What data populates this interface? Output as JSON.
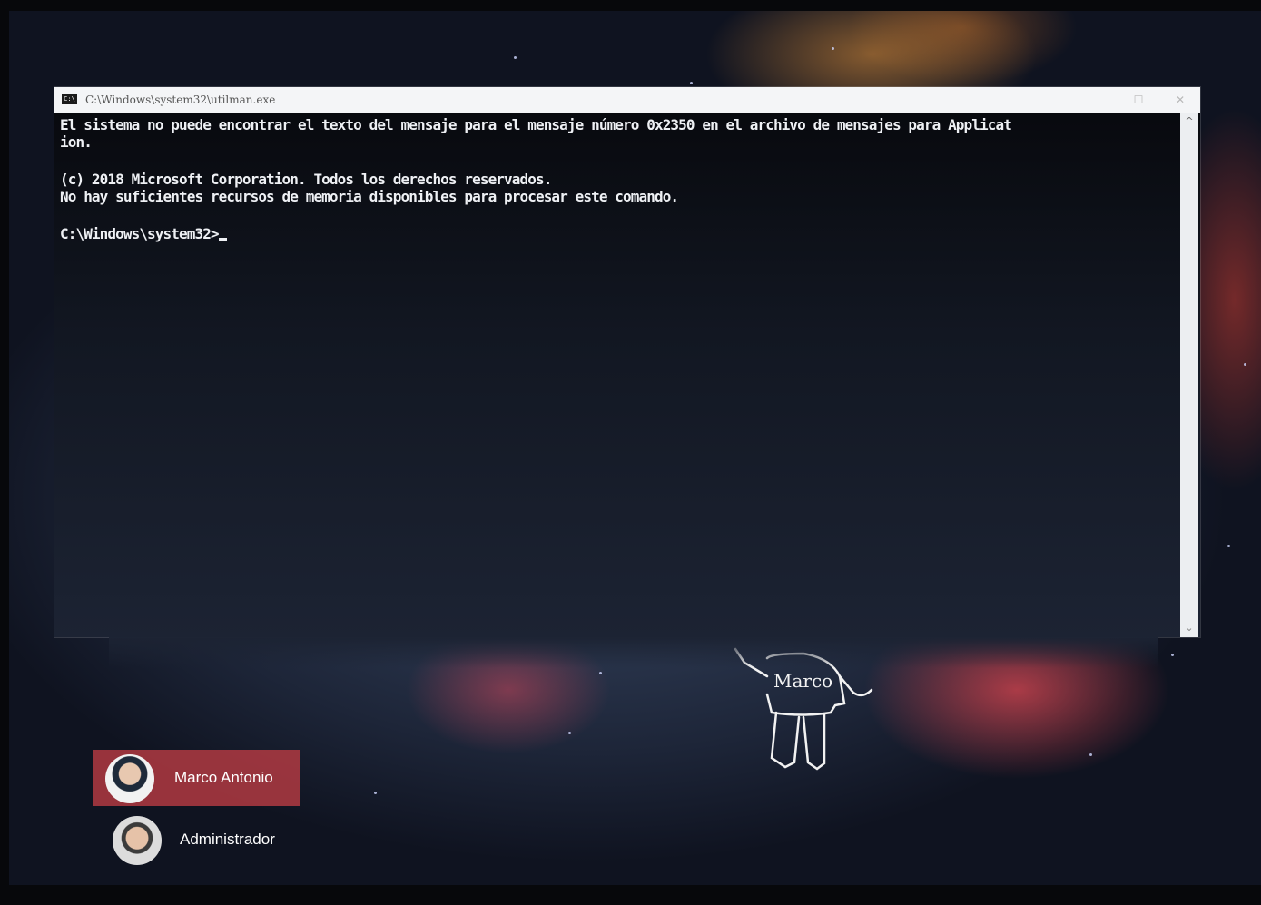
{
  "console": {
    "title": "C:\\Windows\\system32\\utilman.exe",
    "icon_label": "C:\\",
    "window_buttons": {
      "maximize": "☐",
      "close": "✕"
    },
    "lines": [
      "El sistema no puede encontrar el texto del mensaje para el mensaje número 0x2350 en el archivo de mensajes para Applicat",
      "ion.",
      "",
      "(c) 2018 Microsoft Corporation. Todos los derechos reservados.",
      "No hay suficientes recursos de memoria disponibles para procesar este comando.",
      "",
      "C:\\Windows\\system32>"
    ],
    "scroll_up_icon": "chevron-up-icon",
    "scroll_down_icon": "chevron-down-icon"
  },
  "wallpaper": {
    "doodle_text": "Marco"
  },
  "users": [
    {
      "name": "Marco Antonio",
      "selected": true
    },
    {
      "name": "Administrador",
      "selected": false
    }
  ],
  "colors": {
    "selected_user_tile": "#b03a42",
    "console_text": "#eef0f4",
    "title_bar": "#f4f5f7"
  }
}
